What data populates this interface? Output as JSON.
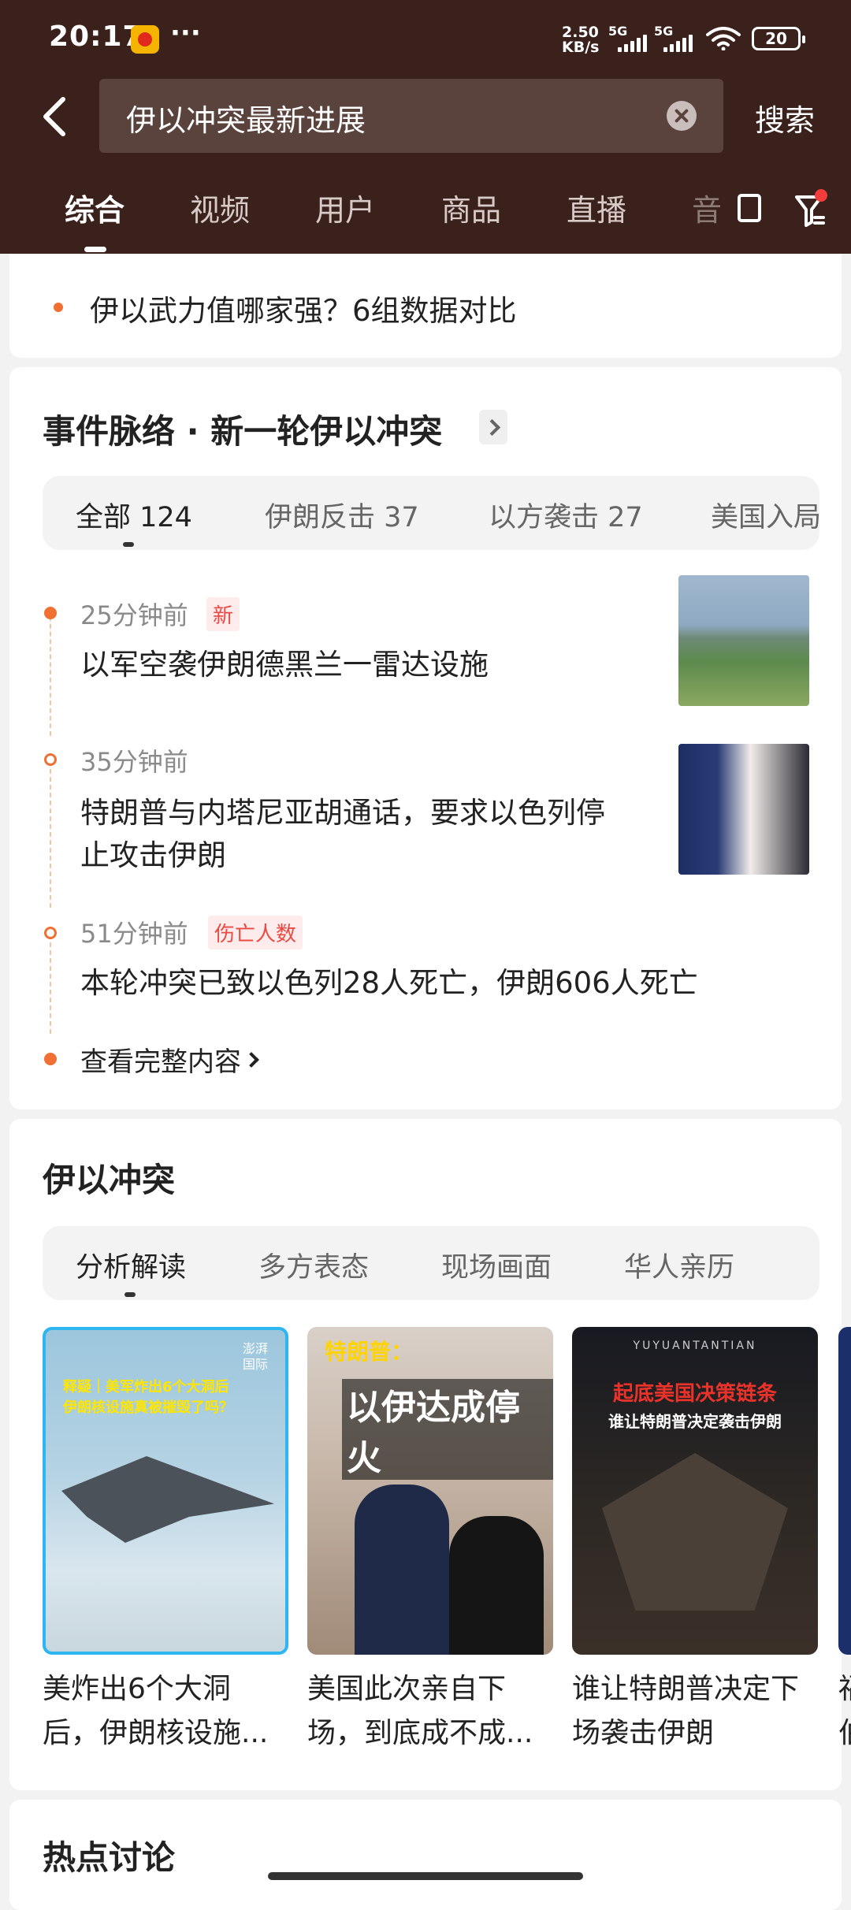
{
  "status_bar": {
    "time": "20:17",
    "more": "···",
    "net_speed_value": "2.50",
    "net_speed_unit": "KB/s",
    "sim1_label": "5G",
    "sim2_label": "5G",
    "battery": "20"
  },
  "search": {
    "query": "伊以冲突最新进展",
    "button": "搜索"
  },
  "tabs": [
    "综合",
    "视频",
    "用户",
    "商品",
    "直播",
    "音"
  ],
  "top_item": "伊以武力值哪家强？6组数据对比",
  "timeline_section": {
    "title": "事件脉络 · 新一轮伊以冲突",
    "pills": [
      "全部 124",
      "伊朗反击 37",
      "以方袭击 27",
      "美国入局"
    ],
    "items": [
      {
        "time": "25分钟前",
        "tag": "新",
        "text": "以军空袭伊朗德黑兰一雷达设施"
      },
      {
        "time": "35分钟前",
        "tag": "",
        "text_line1": "特朗普与内塔尼亚胡通话，要求以色列停",
        "text_line2": "止攻击伊朗"
      },
      {
        "time": "51分钟前",
        "tag": "伤亡人数",
        "text": "本轮冲突已致以色列28人死亡，伊朗606人死亡"
      }
    ],
    "more": "查看完整内容"
  },
  "topic_section": {
    "title": "伊以冲突",
    "pills": [
      "分析解读",
      "多方表态",
      "现场画面",
      "华人亲历"
    ],
    "videos": [
      {
        "overlay": "释疑｜美军炸出6个大洞后 伊朗核设施真被摧毁了吗？",
        "badge": "澎湃国际",
        "title_line1": "美炸出6个大洞",
        "title_line2": "后，伊朗核设施..."
      },
      {
        "overlay_small": "特朗普：",
        "overlay_big": "以伊达成停火",
        "title_line1": "美国此次亲自下",
        "title_line2": "场，到底成不成..."
      },
      {
        "overlay_top": "YUYUANTANTIAN",
        "overlay_red": "起底美国决策链条",
        "overlay_white": "谁让特朗普决定袭击伊朗",
        "title_line1": "谁让特朗普决定下",
        "title_line2": "场袭击伊朗"
      }
    ],
    "partial_title_line1": "福",
    "partial_title_line2": "伯"
  },
  "hot_section": {
    "title": "热点讨论"
  },
  "colors": {
    "header_bg": "#3b211b",
    "accent_orange": "#f07034",
    "tag_red": "#e84a44"
  }
}
